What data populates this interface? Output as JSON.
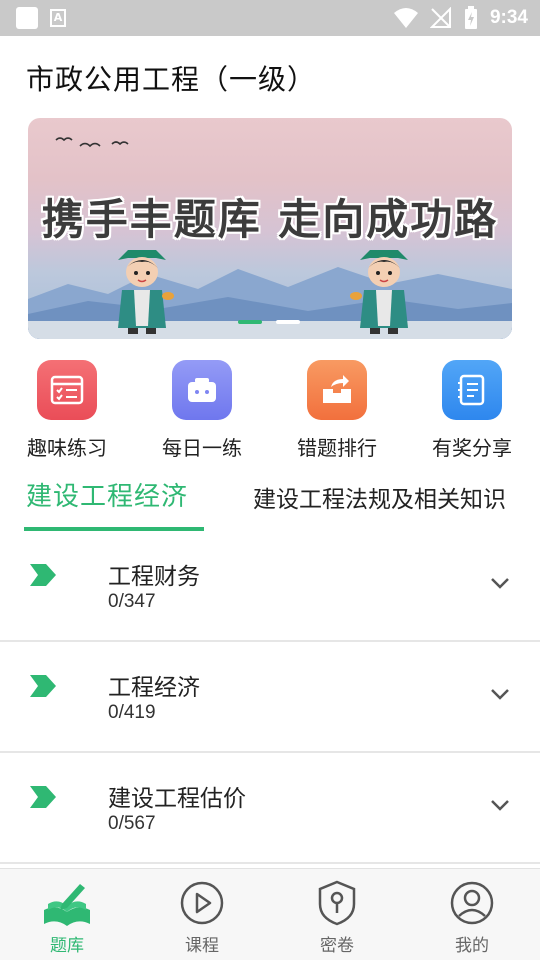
{
  "status_bar": {
    "time": "9:34"
  },
  "page": {
    "title": "市政公用工程（一级）"
  },
  "banner": {
    "slogan": "携手丰题库 走向成功路",
    "active_index": 0,
    "dot_count": 2
  },
  "quick_entries": [
    {
      "label": "趣味练习",
      "icon": "practice-icon",
      "color": "#f05d63"
    },
    {
      "label": "每日一练",
      "icon": "daily-icon",
      "color": "#7f86f2"
    },
    {
      "label": "错题排行",
      "icon": "ranking-icon",
      "color": "#f6834c"
    },
    {
      "label": "有奖分享",
      "icon": "share-icon",
      "color": "#3d97f5"
    }
  ],
  "tabs": [
    {
      "label": "建设工程经济",
      "active": true
    },
    {
      "label": "建设工程法规及相关知识",
      "active": false
    }
  ],
  "list": [
    {
      "title": "工程财务",
      "count": "0/347"
    },
    {
      "title": "工程经济",
      "count": "0/419"
    },
    {
      "title": "建设工程估价",
      "count": "0/567"
    }
  ],
  "bottom_nav": [
    {
      "label": "题库",
      "icon": "question-bank-icon",
      "active": true
    },
    {
      "label": "课程",
      "icon": "play-icon",
      "active": false
    },
    {
      "label": "密卷",
      "icon": "secure-paper-icon",
      "active": false
    },
    {
      "label": "我的",
      "icon": "user-icon",
      "active": false
    }
  ],
  "colors": {
    "accent": "#2fb873",
    "status_bar": "#c9c9c9"
  }
}
